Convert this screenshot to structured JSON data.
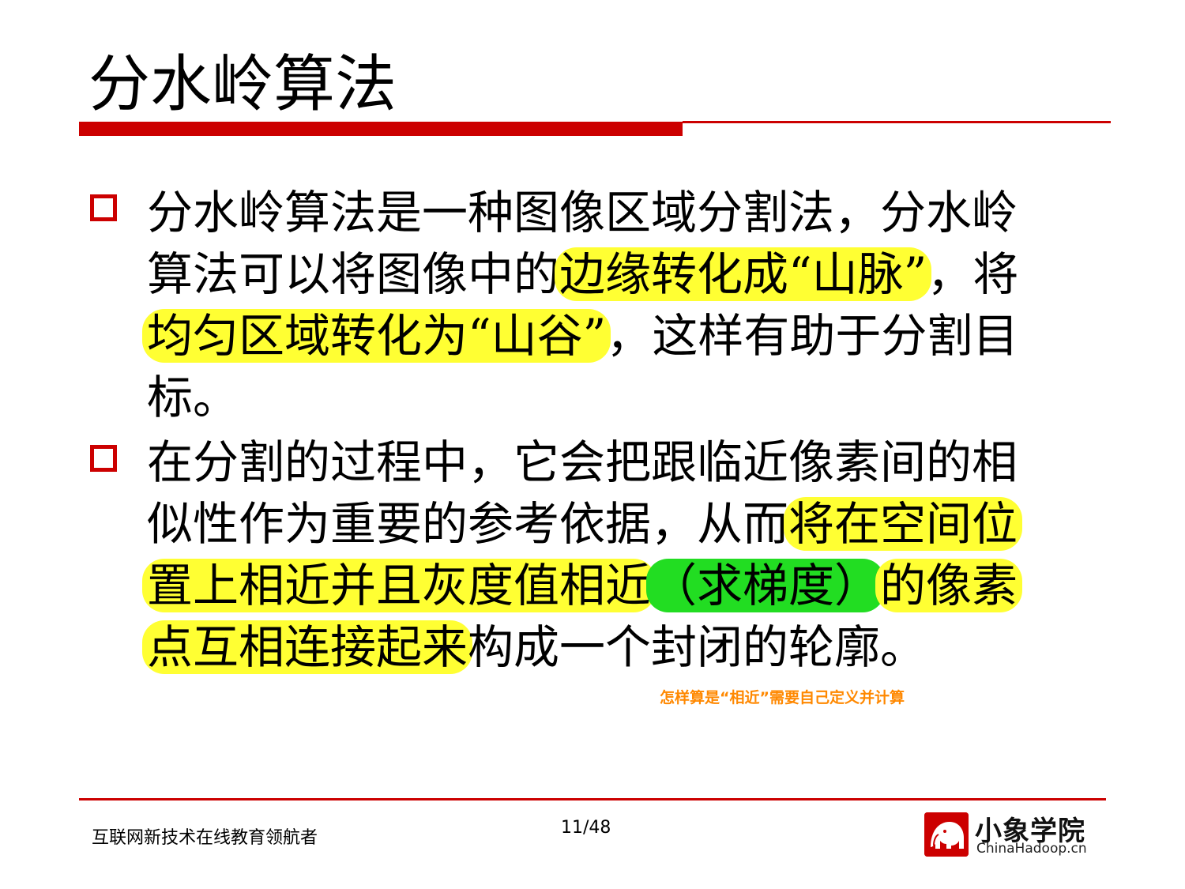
{
  "slide": {
    "title": "分水岭算法",
    "bullet1": {
      "line1": "分水岭算法是一种图像区域分割法，分水岭",
      "line2_plain": "算法可以将图像中的",
      "line2_hl": "边缘转化成“山脉”",
      "line2_tail": "，将",
      "line3_hl": "均匀区域转化为“山谷”",
      "line3_tail": "，这样有助于分割目",
      "line4": "标。"
    },
    "bullet2": {
      "line1": "在分割的过程中，它会把跟临近像素间的相",
      "line2_plain": "似性作为重要的参考依据，从而",
      "line2_hl": "将在空间位",
      "line3_hl": "置上相近并且灰度值相近",
      "line3_green": "（求梯度）",
      "line3_hl2": "的像素",
      "line4_hl": "点互相连接起来",
      "line4_tail": "构成一个封闭的轮廓。"
    },
    "note": "怎样算是“相近”需要自己定义并计算"
  },
  "footer": {
    "slogan": "互联网新技术在线教育领航者",
    "page_number": "11/48",
    "logo_title": "小象学院",
    "logo_url": "ChinaHadoop.cn"
  },
  "colors": {
    "accent": "#cc0000",
    "highlight_yellow": "#ffff33",
    "highlight_green": "#22dd22",
    "note": "#ff8800"
  }
}
